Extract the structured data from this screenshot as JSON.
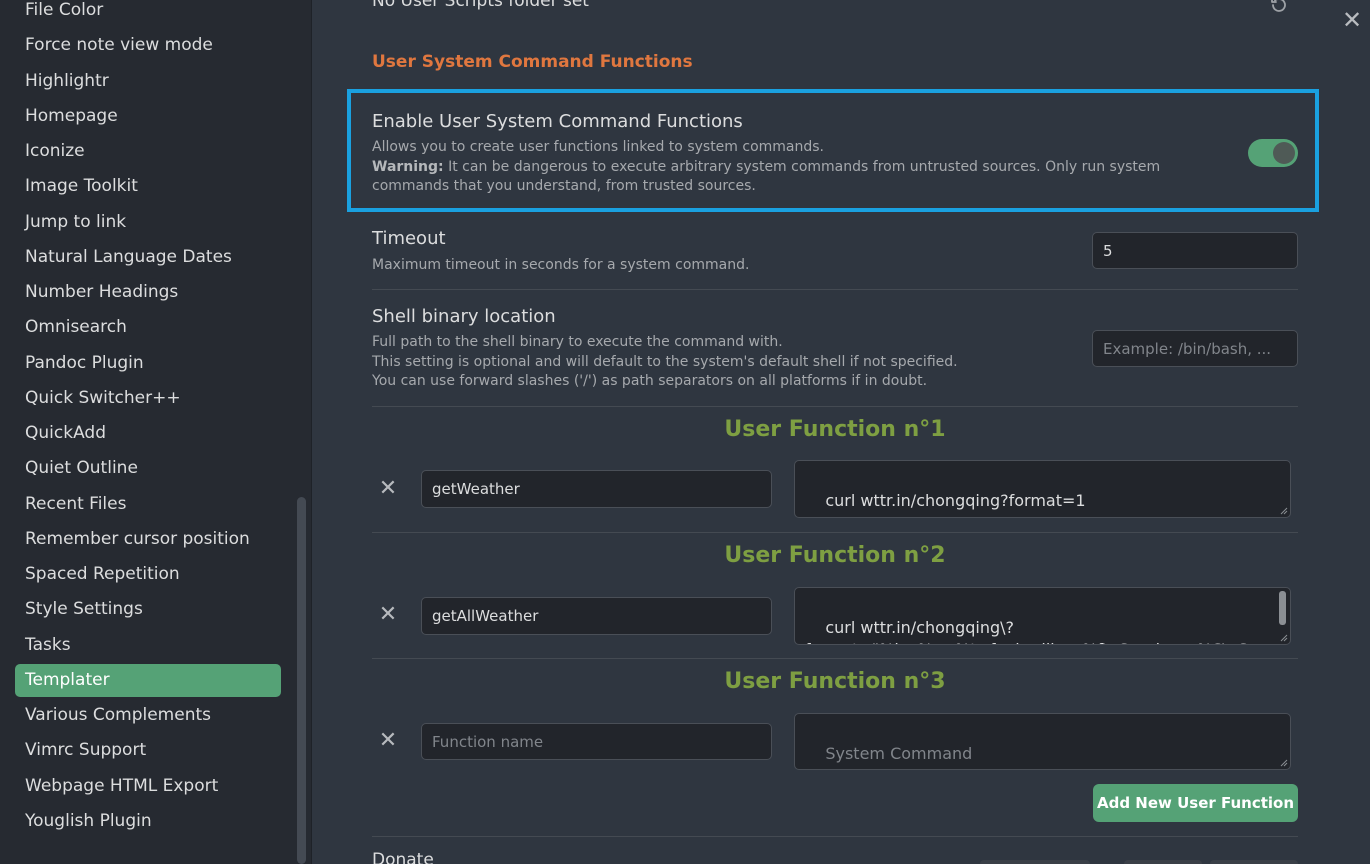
{
  "sidebar": {
    "items": [
      {
        "label": "File Color"
      },
      {
        "label": "Force note view mode"
      },
      {
        "label": "Highlightr"
      },
      {
        "label": "Homepage"
      },
      {
        "label": "Iconize"
      },
      {
        "label": "Image Toolkit"
      },
      {
        "label": "Jump to link"
      },
      {
        "label": "Natural Language Dates"
      },
      {
        "label": "Number Headings"
      },
      {
        "label": "Omnisearch"
      },
      {
        "label": "Pandoc Plugin"
      },
      {
        "label": "Quick Switcher++"
      },
      {
        "label": "QuickAdd"
      },
      {
        "label": "Quiet Outline"
      },
      {
        "label": "Recent Files"
      },
      {
        "label": "Remember cursor position"
      },
      {
        "label": "Spaced Repetition"
      },
      {
        "label": "Style Settings"
      },
      {
        "label": "Tasks"
      },
      {
        "label": "Templater",
        "active": true
      },
      {
        "label": "Various Complements"
      },
      {
        "label": "Vimrc Support"
      },
      {
        "label": "Webpage HTML Export"
      },
      {
        "label": "Youglish Plugin"
      }
    ]
  },
  "main": {
    "top_cut_text": "No User Scripts folder set",
    "section_heading": "User System Command Functions",
    "enable": {
      "name": "Enable User System Command Functions",
      "desc": "Allows you to create user functions linked to system commands.",
      "warning_label": "Warning:",
      "warning_text": " It can be dangerous to execute arbitrary system commands from untrusted sources. Only run system commands that you understand, from trusted sources.",
      "enabled": true
    },
    "timeout": {
      "name": "Timeout",
      "desc": "Maximum timeout in seconds for a system command.",
      "value": "5"
    },
    "shell": {
      "name": "Shell binary location",
      "desc_lines": [
        "Full path to the shell binary to execute the command with.",
        "This setting is optional and will default to the system's default shell if not specified.",
        "You can use forward slashes ('/') as path separators on all platforms if in doubt."
      ],
      "placeholder": "Example: /bin/bash, ..."
    },
    "functions": [
      {
        "heading": "User Function n°1",
        "name": "getWeather",
        "command": "curl wttr.in/chongqing?format=1"
      },
      {
        "heading": "User Function n°2",
        "name": "getAllWeather",
        "command": "curl wttr.in/chongqing\\?\nformat=\"%l:+%c+%t+feels+like+%f\\nSunrise:+%S\\nSunset"
      },
      {
        "heading": "User Function n°3",
        "name": "",
        "command": "",
        "name_placeholder": "Function name",
        "command_placeholder": "System Command"
      }
    ],
    "add_button": "Add New User Function",
    "bottom_cut_text": "Donate"
  },
  "icons": {
    "close": "close-icon",
    "reset": "reset-icon",
    "remove": "x-icon"
  },
  "colors": {
    "accent": "#55a276",
    "heading": "#e0773f",
    "function_heading": "#7e9f42",
    "highlight": "#1aa1e0"
  }
}
